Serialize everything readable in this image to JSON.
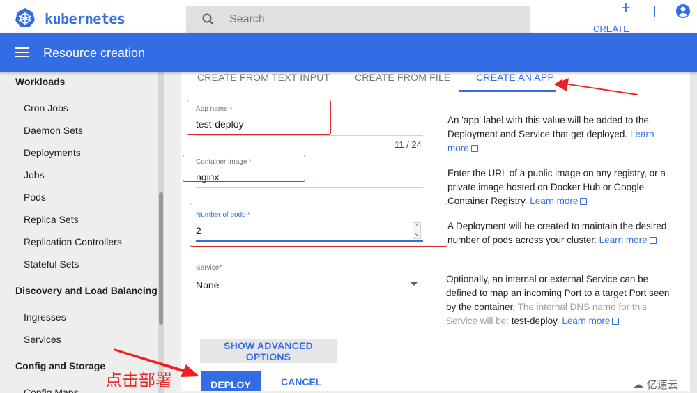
{
  "header": {
    "brand": "kubernetes",
    "search_placeholder": "Search",
    "create_label": "CREATE",
    "brand_color": "#326de6"
  },
  "appbar": {
    "title": "Resource creation"
  },
  "sidebar": {
    "sections": [
      {
        "label": "Workloads",
        "items": [
          "Cron Jobs",
          "Daemon Sets",
          "Deployments",
          "Jobs",
          "Pods",
          "Replica Sets",
          "Replication Controllers",
          "Stateful Sets"
        ]
      },
      {
        "label": "Discovery and Load Balancing",
        "items": [
          "Ingresses",
          "Services"
        ]
      },
      {
        "label": "Config and Storage",
        "items": [
          "Config Maps"
        ]
      }
    ]
  },
  "tabs": [
    {
      "label": "CREATE FROM TEXT INPUT",
      "active": false
    },
    {
      "label": "CREATE FROM FILE",
      "active": false
    },
    {
      "label": "CREATE AN APP",
      "active": true
    }
  ],
  "form": {
    "app_name": {
      "label": "App name *",
      "value": "test-deploy",
      "counter": "11 / 24"
    },
    "container_image": {
      "label": "Container image *",
      "value": "nginx"
    },
    "number_of_pods": {
      "label": "Number of pods *",
      "value": "2",
      "spinner_up": "^",
      "spinner_down": "v"
    },
    "service": {
      "label": "Service*",
      "value": "None"
    },
    "show_advanced_label": "SHOW ADVANCED OPTIONS",
    "deploy_label": "DEPLOY",
    "cancel_label": "CANCEL"
  },
  "help": {
    "app_name": {
      "text": "An 'app' label with this value will be added to the Deployment and Service that get deployed. ",
      "link": "Learn more"
    },
    "container_image": {
      "text": "Enter the URL of a public image on any registry, or a private image hosted on Docker Hub or Google Container Registry. ",
      "link": "Learn more"
    },
    "pods": {
      "text": "A Deployment will be created to maintain the desired number of pods across your cluster. ",
      "link": "Learn more"
    },
    "service": {
      "text": "Optionally, an internal or external Service can be defined to map an incoming Port to a target Port seen by the container. ",
      "muted": "The internal DNS name for this Service will be: ",
      "dns_name": "test-deploy",
      "after": ". ",
      "link": "Learn more"
    }
  },
  "annotations": {
    "callout": "点击部署",
    "watermark": "亿速云",
    "highlight_color": "#d62b2b"
  }
}
